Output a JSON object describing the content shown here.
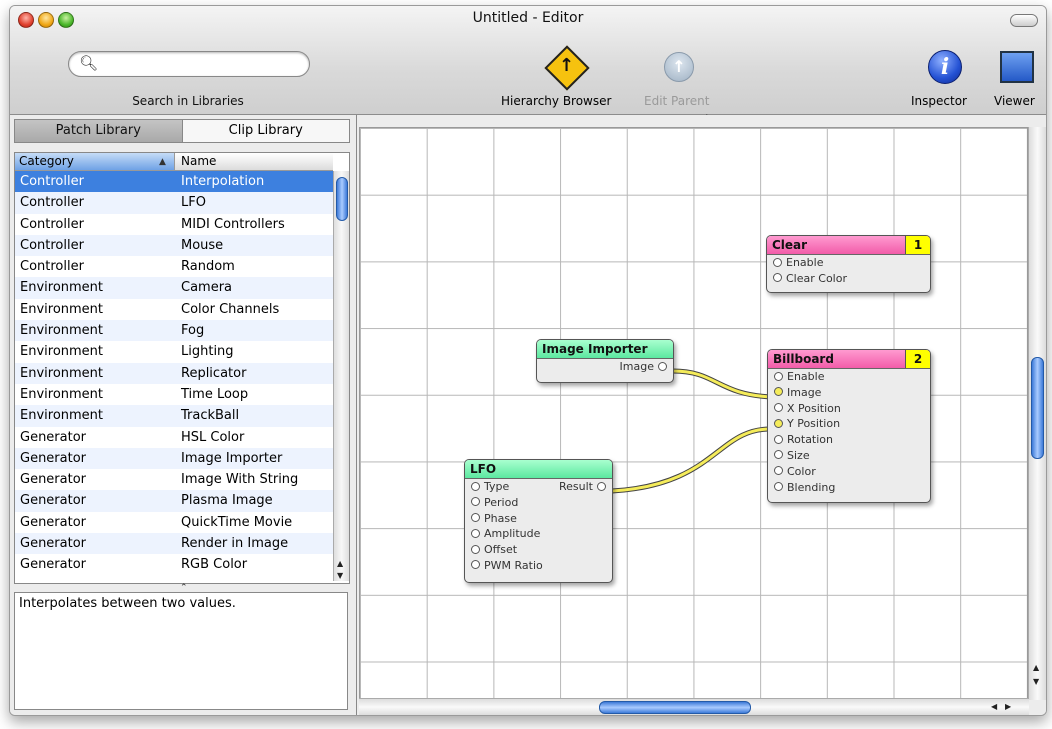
{
  "window": {
    "title": "Untitled - Editor"
  },
  "toolbar": {
    "search_placeholder": "",
    "search_label": "Search in Libraries",
    "hierarchy_browser": "Hierarchy Browser",
    "edit_parent": "Edit Parent",
    "inspector": "Inspector",
    "viewer": "Viewer"
  },
  "library": {
    "tabs": [
      "Patch Library",
      "Clip Library"
    ],
    "columns": [
      "Category",
      "Name"
    ],
    "rows": [
      [
        "Controller",
        "Interpolation"
      ],
      [
        "Controller",
        "LFO"
      ],
      [
        "Controller",
        "MIDI Controllers"
      ],
      [
        "Controller",
        "Mouse"
      ],
      [
        "Controller",
        "Random"
      ],
      [
        "Environment",
        "Camera"
      ],
      [
        "Environment",
        "Color Channels"
      ],
      [
        "Environment",
        "Fog"
      ],
      [
        "Environment",
        "Lighting"
      ],
      [
        "Environment",
        "Replicator"
      ],
      [
        "Environment",
        "Time Loop"
      ],
      [
        "Environment",
        "TrackBall"
      ],
      [
        "Generator",
        "HSL Color"
      ],
      [
        "Generator",
        "Image Importer"
      ],
      [
        "Generator",
        "Image With String"
      ],
      [
        "Generator",
        "Plasma Image"
      ],
      [
        "Generator",
        "QuickTime Movie"
      ],
      [
        "Generator",
        "Render in Image"
      ],
      [
        "Generator",
        "RGB Color"
      ]
    ],
    "description": "Interpolates between two values."
  },
  "patches": {
    "clear": {
      "title": "Clear",
      "order": "1",
      "inputs": [
        "Enable",
        "Clear Color"
      ]
    },
    "billboard": {
      "title": "Billboard",
      "order": "2",
      "inputs": [
        "Enable",
        "Image",
        "X Position",
        "Y Position",
        "Rotation",
        "Size",
        "Color",
        "Blending"
      ]
    },
    "image_importer": {
      "title": "Image Importer",
      "output": "Image"
    },
    "lfo": {
      "title": "LFO",
      "inputs": [
        "Type",
        "Period",
        "Phase",
        "Amplitude",
        "Offset",
        "PWM Ratio"
      ],
      "output": "Result"
    }
  },
  "colors": {
    "selection": "#3d80df",
    "consumer_patch": "#f25ca9",
    "provider_patch": "#5ce8a0",
    "connection": "#f5ec5a"
  }
}
